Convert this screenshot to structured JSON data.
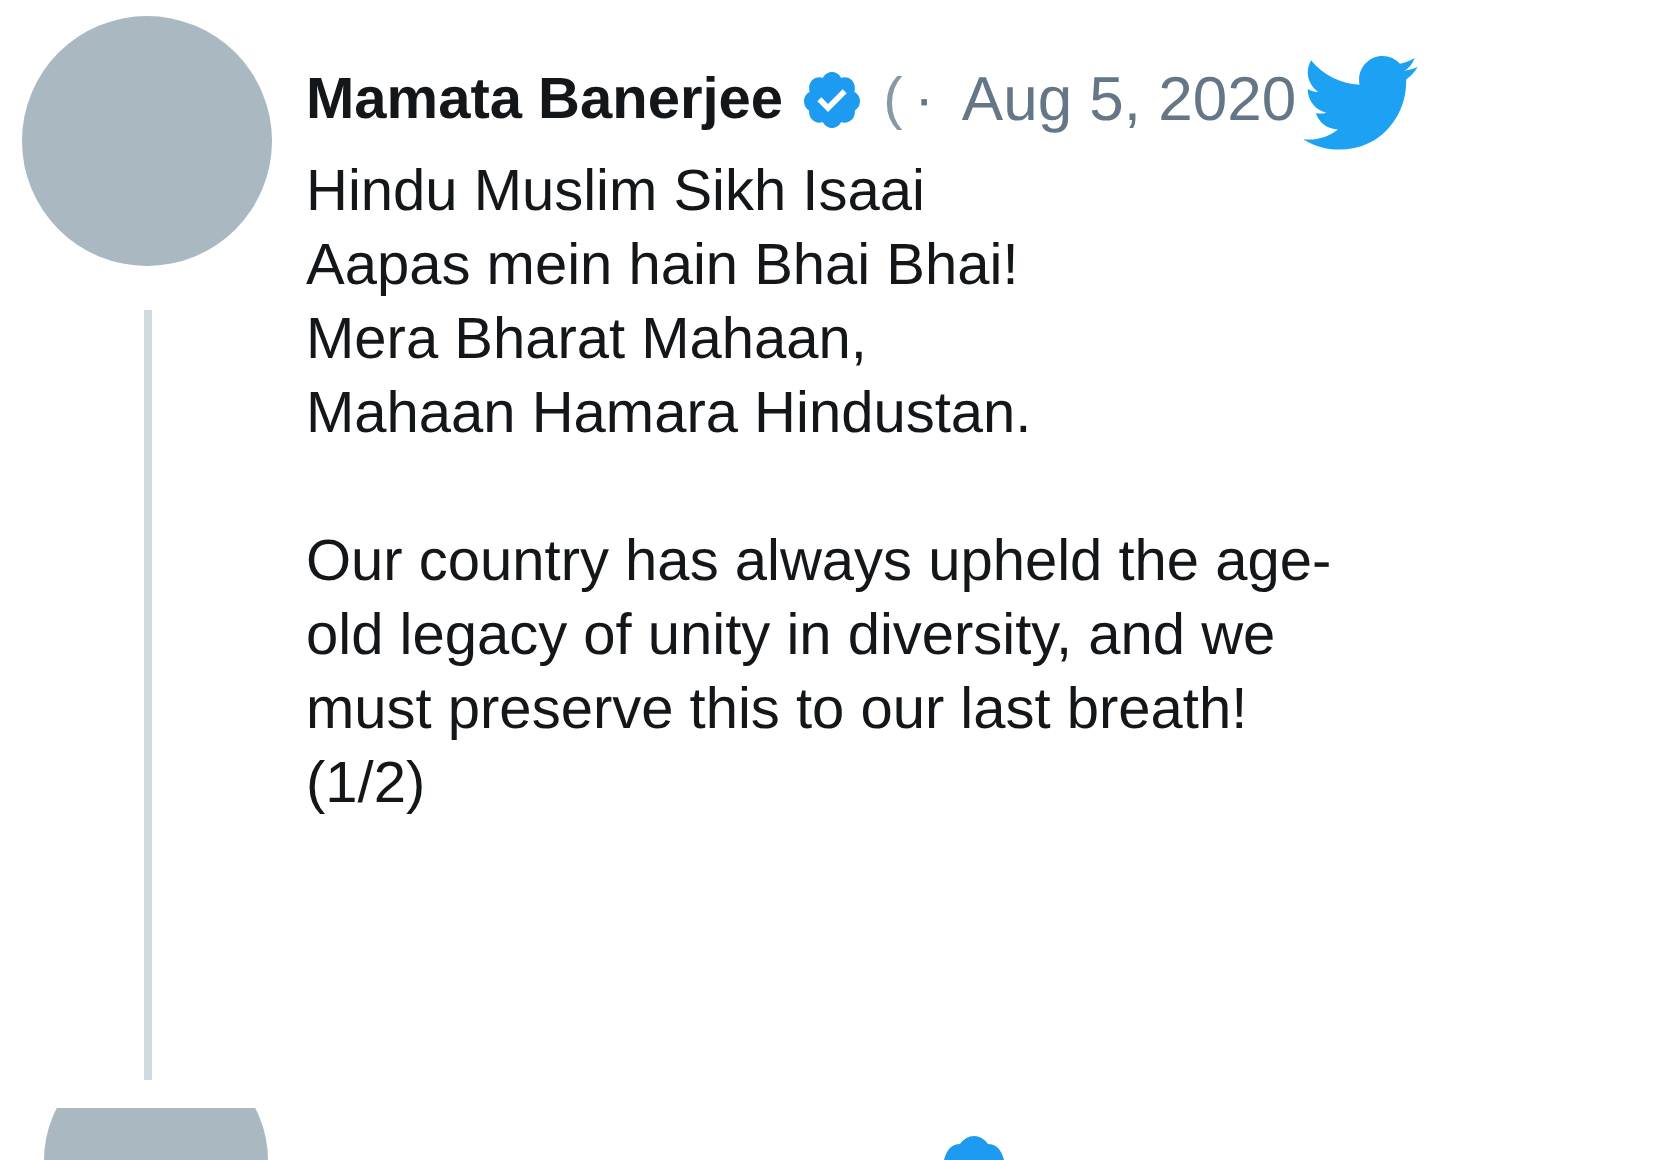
{
  "tweet": {
    "author": "Mamata Banerjee",
    "verified": true,
    "handle": "(",
    "separator": "·",
    "date": "Aug 5, 2020",
    "paragraphs": [
      [
        "Hindu Muslim Sikh Isaai",
        "Aapas mein hain Bhai Bhai!",
        "Mera Bharat Mahaan,",
        "Mahaan Hamara Hindustan."
      ],
      [
        "Our country has always upheld the age-",
        "old legacy of unity in diversity, and we",
        "must preserve this to our last breath!",
        "(1/2)"
      ]
    ],
    "thread": true
  },
  "next_tweet": {
    "verified": true
  }
}
